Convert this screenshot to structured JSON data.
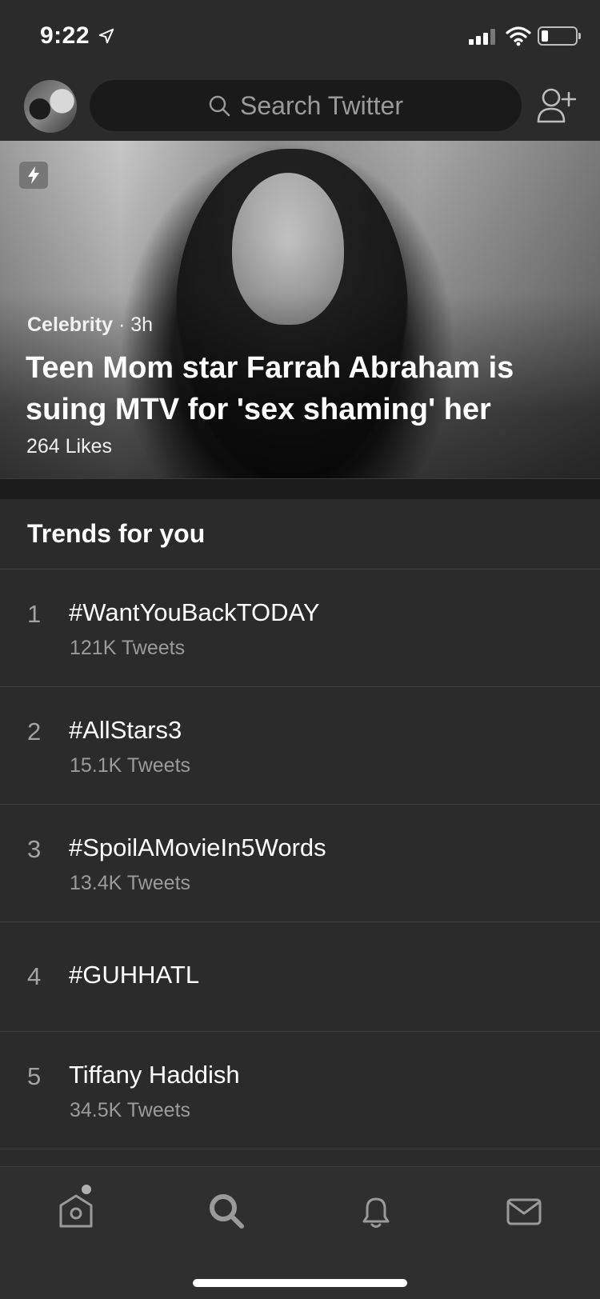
{
  "status_bar": {
    "time": "9:22"
  },
  "search": {
    "placeholder": "Search Twitter"
  },
  "hero": {
    "category": "Celebrity",
    "age": "· 3h",
    "title": "Teen Mom star Farrah Abraham is suing MTV for 'sex shaming' her",
    "likes": "264 Likes"
  },
  "trends": {
    "heading": "Trends for you",
    "items": [
      {
        "rank": "1",
        "name": "#WantYouBackTODAY",
        "count": "121K Tweets"
      },
      {
        "rank": "2",
        "name": "#AllStars3",
        "count": "15.1K Tweets"
      },
      {
        "rank": "3",
        "name": "#SpoilAMovieIn5Words",
        "count": "13.4K Tweets"
      },
      {
        "rank": "4",
        "name": "#GUHHATL",
        "count": ""
      },
      {
        "rank": "5",
        "name": "Tiffany Haddish",
        "count": "34.5K Tweets"
      }
    ]
  },
  "tab_bar": {
    "icons": [
      "home-icon",
      "search-icon",
      "bell-icon",
      "mail-icon"
    ],
    "active": "search"
  },
  "colors": {
    "background": "#2b2b2b",
    "text_primary": "#ffffff",
    "text_secondary": "#9b9b9b",
    "divider": "#3e3e3e"
  }
}
